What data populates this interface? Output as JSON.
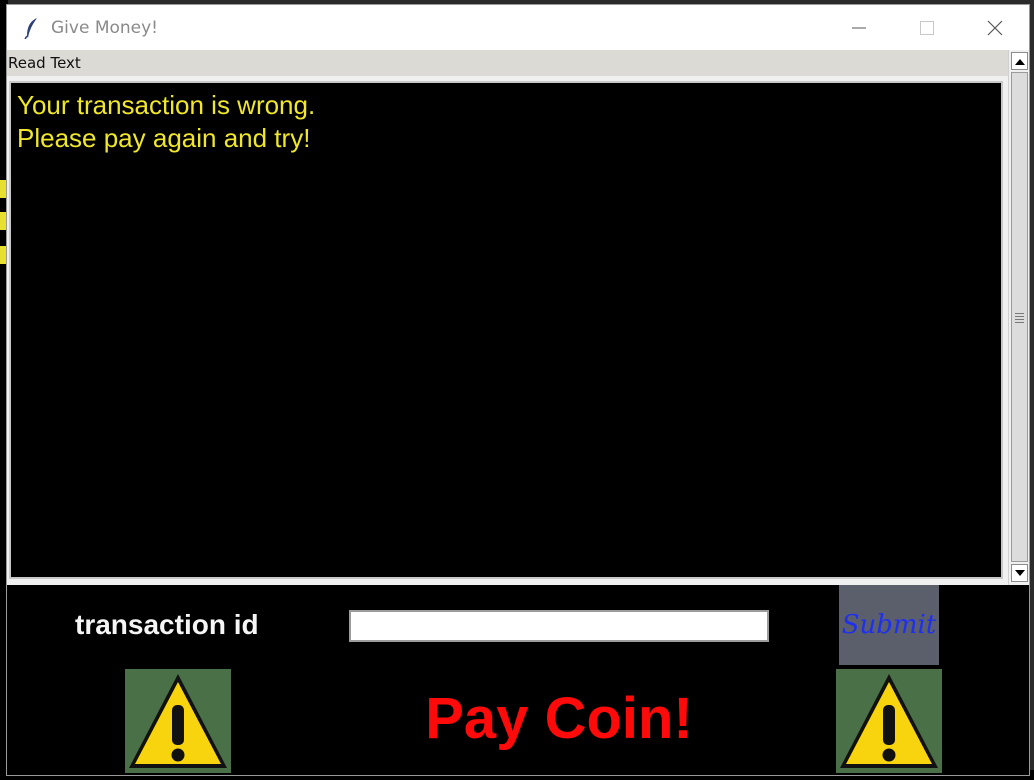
{
  "window": {
    "title": "Give Money!"
  },
  "read_text_label": "Read Text",
  "message_lines": [
    "Your transaction is wrong.",
    "Please pay again and try!"
  ],
  "form": {
    "label": "transaction id",
    "input_value": "",
    "submit_label": "Submit"
  },
  "banner": {
    "text": "Pay Coin!"
  },
  "colors": {
    "text_area_bg": "#000000",
    "text_area_fg": "#f0e62a",
    "banner_fg": "#ff0a0a",
    "submit_fg": "#1f2ff0",
    "submit_bg": "#5b5f6b",
    "warning_bg": "#4a7048"
  },
  "icons": {
    "app": "feather-icon",
    "minimize": "minimize-icon",
    "maximize": "maximize-icon",
    "close": "close-icon",
    "warning": "warning-triangle-icon"
  }
}
